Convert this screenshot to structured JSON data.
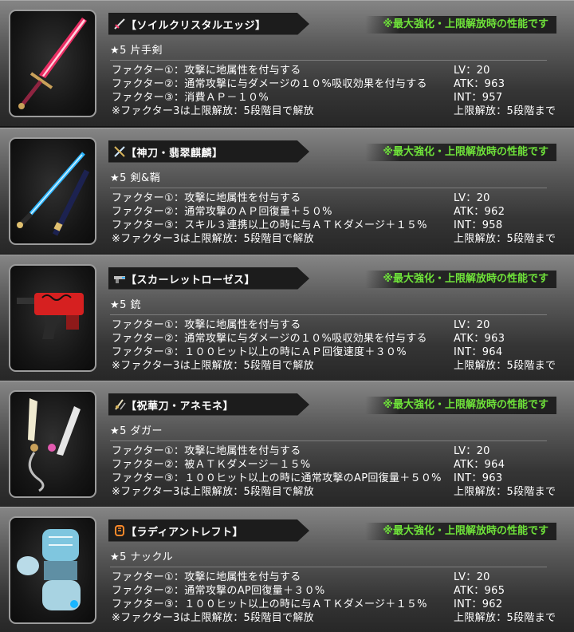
{
  "header_note": "※最大強化・上限解放時の性能です",
  "weapons": [
    {
      "name": "【ソイルクリスタルエッジ】",
      "rarity": "★5 片手剣",
      "factors": [
        "ファクター①：攻撃に地属性を付与する",
        "ファクター②：通常攻撃に与ダメージの１０%吸収効果を付与する",
        "ファクター③：消費ＡＰ－１０%",
        "※ファクター3は上限解放：5段階目で解放"
      ],
      "stats": [
        "LV：20",
        "ATK：963",
        "INT：957",
        "上限解放：5段階まで"
      ],
      "type_icon": "sword-icon",
      "image_icon": "crystal-sword-icon",
      "accent": "#ff2f6a"
    },
    {
      "name": "【神刀・翡翠麒麟】",
      "rarity": "★5 剣&鞘",
      "factors": [
        "ファクター①：攻撃に地属性を付与する",
        "ファクター②：通常攻撃のＡＰ回復量＋５０%",
        "ファクター③：スキル３連携以上の時に与ＡＴＫダメージ＋１５%",
        "※ファクター3は上限解放：5段階目で解放"
      ],
      "stats": [
        "LV：20",
        "ATK：962",
        "INT：958",
        "上限解放：5段階まで"
      ],
      "type_icon": "sword-and-sheath-icon",
      "image_icon": "katana-and-sheath-icon",
      "accent": "#2fb7ff"
    },
    {
      "name": "【スカーレットローゼス】",
      "rarity": "★5 銃",
      "factors": [
        "ファクター①：攻撃に地属性を付与する",
        "ファクター②：通常攻撃に与ダメージの１０%吸収効果を付与する",
        "ファクター③：１００ヒット以上の時にＡＰ回復速度＋３０%",
        "※ファクター3は上限解放：5段階目で解放"
      ],
      "stats": [
        "LV：20",
        "ATK：963",
        "INT：964",
        "上限解放：5段階まで"
      ],
      "type_icon": "gun-icon",
      "image_icon": "rose-gun-icon",
      "accent": "#d62020"
    },
    {
      "name": "【祝華刀・アネモネ】",
      "rarity": "★5 ダガー",
      "factors": [
        "ファクター①：攻撃に地属性を付与する",
        "ファクター②：被ＡＴＫダメージ－１５%",
        "ファクター③：１００ヒット以上の時に通常攻撃のAP回復量＋５０%",
        "※ファクター3は上限解放：5段階目で解放"
      ],
      "stats": [
        "LV：20",
        "ATK：964",
        "INT：963",
        "上限解放：5段階まで"
      ],
      "type_icon": "dagger-icon",
      "image_icon": "twin-daggers-icon",
      "accent": "#e35ab0"
    },
    {
      "name": "【ラディアントレフト】",
      "rarity": "★5 ナックル",
      "factors": [
        "ファクター①：攻撃に地属性を付与する",
        "ファクター②：通常攻撃のAP回復量＋３０%",
        "ファクター③：１００ヒット以上の時に与ＡＴＫダメージ＋１５%",
        "※ファクター3は上限解放：5段階目で解放"
      ],
      "stats": [
        "LV：20",
        "ATK：965",
        "INT：962",
        "上限解放：5段階まで"
      ],
      "type_icon": "knuckle-icon",
      "image_icon": "crystal-gauntlet-icon",
      "accent": "#7fc6df"
    }
  ]
}
